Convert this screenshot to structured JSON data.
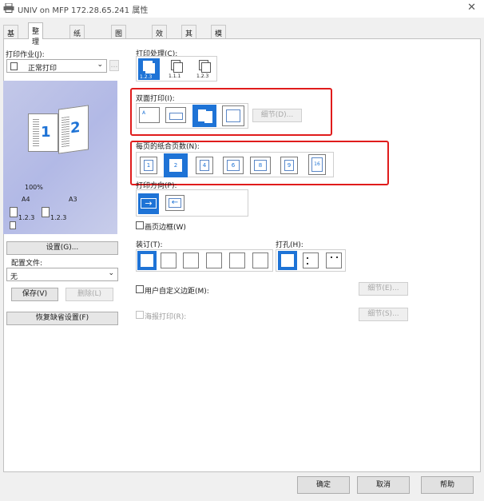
{
  "window": {
    "title": "UNIV on MFP 172.28.65.241 属性",
    "close": "✕"
  },
  "tabs": [
    "基本",
    "整理",
    "纸张处理",
    "图像质量",
    "效果",
    "其它",
    "模板"
  ],
  "left": {
    "job_label": "打印作业(J):",
    "job_value": "正常打印",
    "preview_zoom": "100%",
    "preview_size_a4": "A4",
    "preview_size_a3": "A3",
    "preview_page1": "1",
    "preview_page2": "2",
    "collate_a": "1.2.3",
    "collate_b": "1.2.3",
    "settings_button": "设置(G)...",
    "config_label": "配置文件:",
    "config_value": "无",
    "save_button": "保存(V)",
    "delete_button": "删除(L)",
    "restore_button": "恢复缺省设置(F)"
  },
  "print_process": {
    "label": "打印处理(C):",
    "icons": [
      {
        "name": "collate-icon",
        "caption": "1.2.3",
        "selected": true
      },
      {
        "name": "group-icon",
        "caption": "1.1.1",
        "selected": false
      },
      {
        "name": "stack-icon",
        "caption": "1.2.3",
        "selected": false
      }
    ]
  },
  "duplex": {
    "label": "双面打印(I):",
    "detail_button": "细节(D)...",
    "selected_index": 2
  },
  "nup": {
    "label": "每页的纸合页数(N):",
    "values": [
      "1",
      "2",
      "4",
      "6",
      "8",
      "9",
      "16"
    ],
    "selected_index": 1
  },
  "orientation": {
    "label": "打印方向(P):",
    "selected_index": 0
  },
  "page_border": {
    "label": "画页边框(W)"
  },
  "binding": {
    "label": "装订(T):",
    "selected_index": 0
  },
  "punch": {
    "label": "打孔(H):",
    "selected_index": 0
  },
  "custom_margin": {
    "label": "用户自定义边距(M):",
    "detail_button": "细节(E)..."
  },
  "poster": {
    "label": "海报打印(R):",
    "detail_button": "细节(S)..."
  },
  "footer": {
    "ok": "确定",
    "cancel": "取消",
    "help": "帮助"
  },
  "colors": {
    "accent": "#1e73d6",
    "highlight": "#e01c1c"
  }
}
